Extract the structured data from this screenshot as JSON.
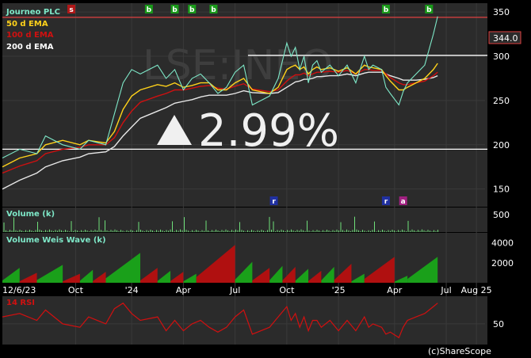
{
  "chart_data": {
    "type": "line",
    "ticker_watermark": "LSE:JNEO",
    "change_banner": "2.99%",
    "last_price_label": "344.0",
    "copyright": "(c)ShareScope",
    "x_start_label": "12/6/23",
    "x_tick_labels": [
      "Oct",
      "'24",
      "Apr",
      "Jul",
      "Oct",
      "'25",
      "Apr",
      "Jul",
      "Aug 25"
    ],
    "price_panel": {
      "legend": [
        {
          "name": "Journeo PLC",
          "color": "#7ee8c8"
        },
        {
          "name": "50 d  EMA",
          "color": "#ffd21a"
        },
        {
          "name": "100 d  EMA",
          "color": "#d01010"
        },
        {
          "name": "200 d  EMA",
          "color": "#ffffff"
        }
      ],
      "y_ticks": [
        "350",
        "300",
        "250",
        "200",
        "150"
      ],
      "ylim": [
        130,
        360
      ],
      "hlines": [
        {
          "value": 344,
          "color": "#e04040"
        },
        {
          "value": 301,
          "color": "#ffffff"
        },
        {
          "value": 195,
          "color": "#ffffff"
        }
      ],
      "price_x": [
        0,
        4,
        8,
        10,
        14,
        18,
        20,
        24,
        26,
        28,
        30,
        32,
        36,
        38,
        40,
        42,
        44,
        46,
        48,
        50,
        52,
        54,
        56,
        58,
        62,
        64,
        66,
        67,
        68,
        69,
        70,
        71,
        72,
        73,
        74,
        76,
        78,
        80,
        82,
        84,
        85,
        86,
        88,
        89,
        90,
        92,
        93,
        94,
        96,
        98,
        100,
        101
      ],
      "price_y": [
        185,
        195,
        190,
        210,
        200,
        195,
        205,
        200,
        235,
        270,
        285,
        280,
        290,
        275,
        285,
        262,
        275,
        280,
        270,
        258,
        265,
        282,
        290,
        245,
        255,
        275,
        315,
        300,
        310,
        285,
        300,
        270,
        290,
        295,
        282,
        290,
        278,
        290,
        270,
        300,
        285,
        290,
        285,
        265,
        258,
        245,
        260,
        270,
        280,
        290,
        325,
        345
      ],
      "ema50_y": [
        175,
        185,
        190,
        200,
        205,
        200,
        205,
        202,
        215,
        240,
        255,
        262,
        268,
        266,
        270,
        265,
        267,
        270,
        270,
        262,
        262,
        270,
        275,
        262,
        258,
        265,
        285,
        288,
        290,
        285,
        288,
        280,
        285,
        288,
        285,
        287,
        283,
        287,
        280,
        290,
        288,
        287,
        285,
        278,
        272,
        262,
        262,
        265,
        270,
        275,
        285,
        292
      ],
      "ema100_y": [
        168,
        176,
        182,
        190,
        195,
        197,
        200,
        200,
        208,
        225,
        238,
        248,
        255,
        258,
        262,
        262,
        264,
        266,
        267,
        264,
        263,
        266,
        269,
        263,
        260,
        262,
        272,
        276,
        279,
        279,
        281,
        278,
        280,
        282,
        282,
        283,
        282,
        284,
        280,
        285,
        285,
        284,
        284,
        280,
        276,
        270,
        268,
        268,
        270,
        272,
        278,
        282
      ],
      "ema200_y": [
        150,
        160,
        168,
        175,
        182,
        186,
        190,
        192,
        198,
        210,
        220,
        230,
        238,
        242,
        247,
        249,
        251,
        254,
        256,
        256,
        256,
        258,
        261,
        259,
        258,
        259,
        265,
        268,
        271,
        272,
        274,
        274,
        275,
        277,
        277,
        278,
        278,
        280,
        278,
        281,
        282,
        282,
        282,
        280,
        278,
        275,
        273,
        273,
        273,
        274,
        276,
        278
      ],
      "signals": [
        {
          "label": "s",
          "x": 16,
          "color": "#b01818"
        },
        {
          "label": "b",
          "x": 34,
          "color": "#1a9a1a"
        },
        {
          "label": "b",
          "x": 40,
          "color": "#1a9a1a"
        },
        {
          "label": "b",
          "x": 44,
          "color": "#1a9a1a"
        },
        {
          "label": "b",
          "x": 49,
          "color": "#1a9a1a"
        },
        {
          "label": "b",
          "x": 89,
          "color": "#1a9a1a"
        },
        {
          "label": "b",
          "x": 99,
          "color": "#1a9a1a"
        }
      ],
      "events": [
        {
          "label": "r",
          "x": 63,
          "color": "#2030a0"
        },
        {
          "label": "r",
          "x": 89,
          "color": "#2030a0"
        },
        {
          "label": "a",
          "x": 93,
          "color": "#a02080"
        }
      ]
    },
    "volume_panel": {
      "title": "Volume (k)",
      "y_ticks": [
        "500"
      ],
      "ylim": [
        0,
        700
      ]
    },
    "weis_panel": {
      "title": "Volume Weis Wave (k)",
      "y_ticks": [
        "4000",
        "2000"
      ],
      "ylim": [
        0,
        5000
      ],
      "waves": [
        {
          "x0": 0,
          "x1": 4,
          "peak": 1500,
          "color": "#1aa01a"
        },
        {
          "x0": 4,
          "x1": 8,
          "peak": 1000,
          "color": "#b01010"
        },
        {
          "x0": 8,
          "x1": 14,
          "peak": 1800,
          "color": "#1aa01a"
        },
        {
          "x0": 14,
          "x1": 18,
          "peak": 900,
          "color": "#b01010"
        },
        {
          "x0": 18,
          "x1": 21,
          "peak": 1300,
          "color": "#1aa01a"
        },
        {
          "x0": 21,
          "x1": 24,
          "peak": 1100,
          "color": "#b01010"
        },
        {
          "x0": 24,
          "x1": 32,
          "peak": 3000,
          "color": "#1aa01a"
        },
        {
          "x0": 32,
          "x1": 36,
          "peak": 1500,
          "color": "#b01010"
        },
        {
          "x0": 36,
          "x1": 39,
          "peak": 1200,
          "color": "#1aa01a"
        },
        {
          "x0": 39,
          "x1": 42,
          "peak": 1100,
          "color": "#b01010"
        },
        {
          "x0": 42,
          "x1": 45,
          "peak": 900,
          "color": "#1aa01a"
        },
        {
          "x0": 45,
          "x1": 54,
          "peak": 3800,
          "color": "#b01010"
        },
        {
          "x0": 54,
          "x1": 58,
          "peak": 2100,
          "color": "#1aa01a"
        },
        {
          "x0": 58,
          "x1": 62,
          "peak": 1500,
          "color": "#b01010"
        },
        {
          "x0": 62,
          "x1": 65,
          "peak": 1700,
          "color": "#1aa01a"
        },
        {
          "x0": 65,
          "x1": 68,
          "peak": 1600,
          "color": "#b01010"
        },
        {
          "x0": 68,
          "x1": 71,
          "peak": 1400,
          "color": "#1aa01a"
        },
        {
          "x0": 71,
          "x1": 74,
          "peak": 1200,
          "color": "#b01010"
        },
        {
          "x0": 74,
          "x1": 77,
          "peak": 1600,
          "color": "#1aa01a"
        },
        {
          "x0": 77,
          "x1": 81,
          "peak": 1900,
          "color": "#b01010"
        },
        {
          "x0": 81,
          "x1": 84,
          "peak": 900,
          "color": "#1aa01a"
        },
        {
          "x0": 84,
          "x1": 91,
          "peak": 2600,
          "color": "#b01010"
        },
        {
          "x0": 91,
          "x1": 94,
          "peak": 700,
          "color": "#1aa01a"
        },
        {
          "x0": 94,
          "x1": 101,
          "peak": 2600,
          "color": "#1aa01a"
        }
      ]
    },
    "rsi_panel": {
      "title": "14 RSI",
      "y_ticks": [
        "50"
      ],
      "ylim": [
        20,
        90
      ],
      "rsi_x": [
        0,
        4,
        8,
        10,
        14,
        18,
        20,
        24,
        26,
        28,
        30,
        32,
        36,
        38,
        40,
        42,
        44,
        46,
        48,
        50,
        52,
        54,
        56,
        58,
        62,
        64,
        66,
        67,
        68,
        69,
        70,
        71,
        72,
        73,
        74,
        76,
        78,
        80,
        82,
        84,
        85,
        86,
        88,
        89,
        90,
        92,
        93,
        94,
        96,
        98,
        100,
        101
      ],
      "rsi_y": [
        60,
        65,
        55,
        70,
        50,
        45,
        60,
        50,
        72,
        80,
        65,
        55,
        60,
        40,
        55,
        40,
        50,
        55,
        45,
        38,
        45,
        60,
        70,
        35,
        45,
        60,
        75,
        55,
        65,
        45,
        60,
        40,
        55,
        55,
        45,
        55,
        40,
        55,
        40,
        60,
        45,
        50,
        45,
        35,
        38,
        30,
        45,
        55,
        60,
        65,
        75,
        80
      ]
    }
  }
}
